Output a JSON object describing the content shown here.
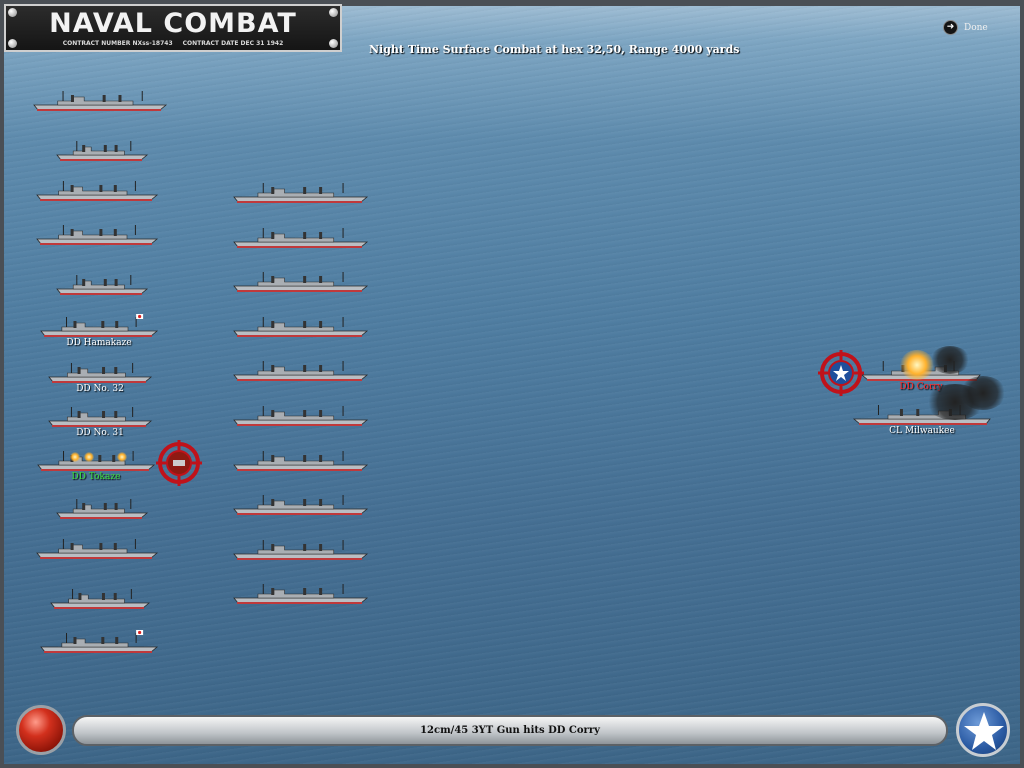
{
  "title": {
    "main": "NAVAL COMBAT",
    "contract_number": "CONTRACT NUMBER   NXss-18743",
    "contract_date": "CONTRACT DATE  DEC 31 1942"
  },
  "combat_info": "Night Time Surface Combat at hex 32,50, Range 4000 yards",
  "done_label": "Done",
  "message": "12cm/45 3YT Gun hits DD Corry",
  "colors": {
    "label_default": "#ffffff",
    "label_hit": "#ff2a2a",
    "label_firing": "#3ddc3d",
    "hull": "#b9bec3",
    "waterline": "#c0393b"
  },
  "japanese_column_1": [
    {
      "name": "",
      "flag": false
    },
    {
      "name": "",
      "flag": false
    },
    {
      "name": "",
      "flag": false
    },
    {
      "name": "",
      "flag": false
    },
    {
      "name": "",
      "flag": false
    },
    {
      "name": "DD Hamakaze",
      "flag": true
    },
    {
      "name": "DD No. 32",
      "flag": false
    },
    {
      "name": "DD No. 31",
      "flag": false
    },
    {
      "name": "DD Tokaze",
      "flag": false,
      "firing": true
    },
    {
      "name": "",
      "flag": false
    },
    {
      "name": "",
      "flag": false
    },
    {
      "name": "",
      "flag": false
    },
    {
      "name": "",
      "flag": true
    }
  ],
  "japanese_column_2": [
    "",
    "",
    "",
    "",
    "",
    "",
    "",
    "",
    "",
    ""
  ],
  "allied_ships": [
    {
      "name": "DD Corry",
      "status": "hit"
    },
    {
      "name": "CL Milwaukee",
      "status": "damaged"
    }
  ],
  "icons": {
    "done": "arrow-circle-icon",
    "left_button": "red-button-icon",
    "right_button": "us-star-icon",
    "target_allied": "target-reticle-star-icon",
    "target_japanese": "target-reticle-icon"
  }
}
